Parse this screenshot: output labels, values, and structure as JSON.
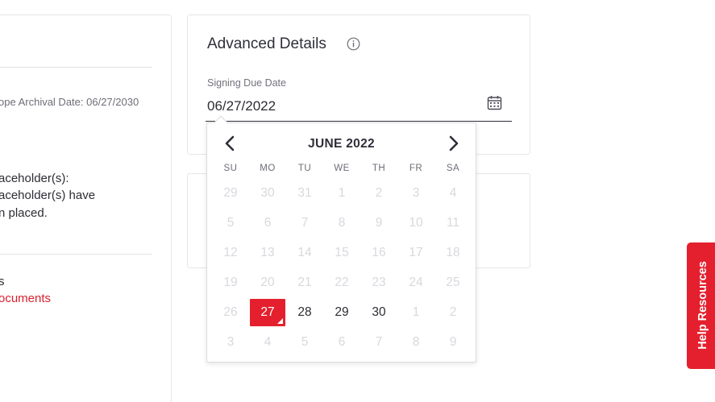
{
  "left_panel": {
    "archival_text": "ope Archival Date: 06/27/2030",
    "placeholder_heading": "aceholder(s):",
    "placeholder_line1": "aceholder(s) have",
    "placeholder_line2": "n placed.",
    "item_text": "s",
    "documents_link": "ocuments"
  },
  "advanced": {
    "title": "Advanced Details",
    "info_icon": "info-circle-icon",
    "due_label": "Signing Due Date",
    "due_value": "06/27/2022",
    "calendar_icon": "calendar-icon"
  },
  "datepicker": {
    "month_title": "JUNE 2022",
    "prev_icon": "chevron-left-icon",
    "next_icon": "chevron-right-icon",
    "weekdays": [
      "SU",
      "MO",
      "TU",
      "WE",
      "TH",
      "FR",
      "SA"
    ],
    "weeks": [
      [
        {
          "d": "29",
          "a": false
        },
        {
          "d": "30",
          "a": false
        },
        {
          "d": "31",
          "a": false
        },
        {
          "d": "1",
          "a": false
        },
        {
          "d": "2",
          "a": false
        },
        {
          "d": "3",
          "a": false
        },
        {
          "d": "4",
          "a": false
        }
      ],
      [
        {
          "d": "5",
          "a": false
        },
        {
          "d": "6",
          "a": false
        },
        {
          "d": "7",
          "a": false
        },
        {
          "d": "8",
          "a": false
        },
        {
          "d": "9",
          "a": false
        },
        {
          "d": "10",
          "a": false
        },
        {
          "d": "11",
          "a": false
        }
      ],
      [
        {
          "d": "12",
          "a": false
        },
        {
          "d": "13",
          "a": false
        },
        {
          "d": "14",
          "a": false
        },
        {
          "d": "15",
          "a": false
        },
        {
          "d": "16",
          "a": false
        },
        {
          "d": "17",
          "a": false
        },
        {
          "d": "18",
          "a": false
        }
      ],
      [
        {
          "d": "19",
          "a": false
        },
        {
          "d": "20",
          "a": false
        },
        {
          "d": "21",
          "a": false
        },
        {
          "d": "22",
          "a": false
        },
        {
          "d": "23",
          "a": false
        },
        {
          "d": "24",
          "a": false
        },
        {
          "d": "25",
          "a": false
        }
      ],
      [
        {
          "d": "26",
          "a": false
        },
        {
          "d": "27",
          "a": true,
          "selected": true
        },
        {
          "d": "28",
          "a": true
        },
        {
          "d": "29",
          "a": true
        },
        {
          "d": "30",
          "a": true
        },
        {
          "d": "1",
          "a": false
        },
        {
          "d": "2",
          "a": false
        }
      ],
      [
        {
          "d": "3",
          "a": false
        },
        {
          "d": "4",
          "a": false
        },
        {
          "d": "5",
          "a": false
        },
        {
          "d": "6",
          "a": false
        },
        {
          "d": "7",
          "a": false
        },
        {
          "d": "8",
          "a": false
        },
        {
          "d": "9",
          "a": false
        }
      ]
    ]
  },
  "help": {
    "label": "Help Resources"
  },
  "colors": {
    "accent": "#e5202e",
    "text": "#2c2c34",
    "disabled": "#d8d8de"
  }
}
